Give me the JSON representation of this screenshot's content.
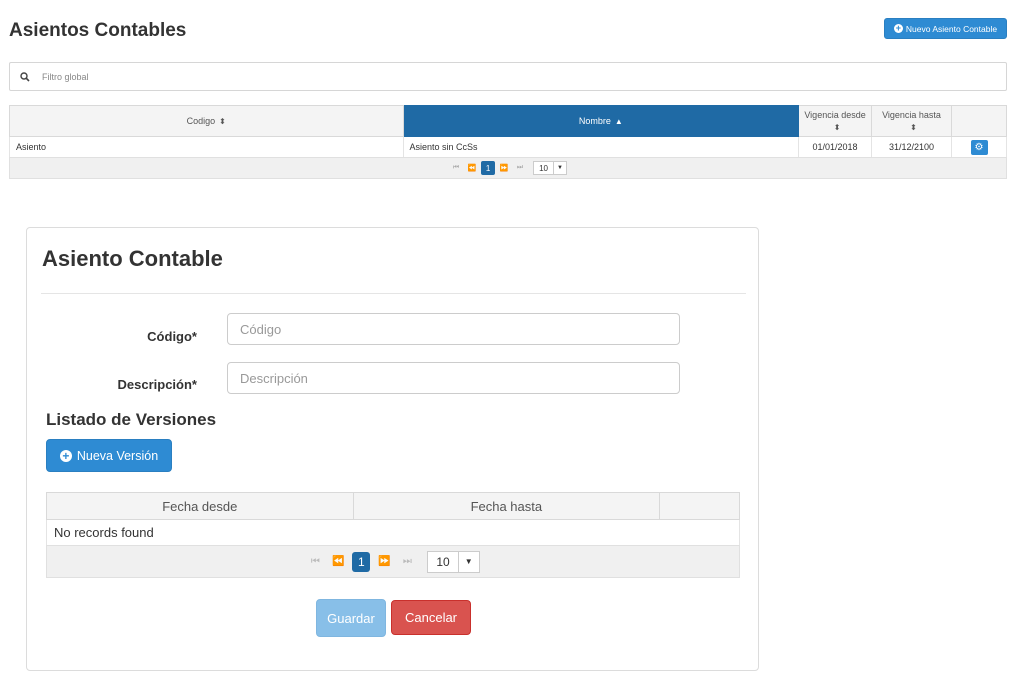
{
  "header": {
    "title": "Asientos Contables",
    "new_button_label": "Nuevo Asiento Contable"
  },
  "filter": {
    "placeholder": "Filtro global",
    "icon": "search-icon"
  },
  "table": {
    "columns": [
      "Codigo",
      "Nombre",
      "Vigencia desde",
      "Vigencia hasta"
    ],
    "rows": [
      {
        "codigo": "Asiento",
        "nombre": "Asiento sin CcSs",
        "vigencia_desde": "01/01/2018",
        "vigencia_hasta": "31/12/2100"
      }
    ],
    "paginator": {
      "current_page": "1",
      "rows_per_page": "10"
    },
    "active_column_color": "#1f6aa5"
  },
  "form": {
    "title": "Asiento Contable",
    "codigo_label": "Código*",
    "codigo_placeholder": "Código",
    "codigo_value": "",
    "descripcion_label": "Descripción*",
    "descripcion_placeholder": "Descripción",
    "descripcion_value": "",
    "versions_title": "Listado de Versiones",
    "new_version_label": "Nueva Versión",
    "versions_table": {
      "columns": [
        "Fecha desde",
        "Fecha hasta"
      ],
      "empty_message": "No records found",
      "paginator": {
        "current_page": "1",
        "rows_per_page": "10"
      }
    },
    "save_label": "Guardar",
    "cancel_label": "Cancelar"
  },
  "colors": {
    "primary": "#2e8bd3",
    "danger": "#d9534f",
    "disabled_primary": "#88bfe8"
  }
}
